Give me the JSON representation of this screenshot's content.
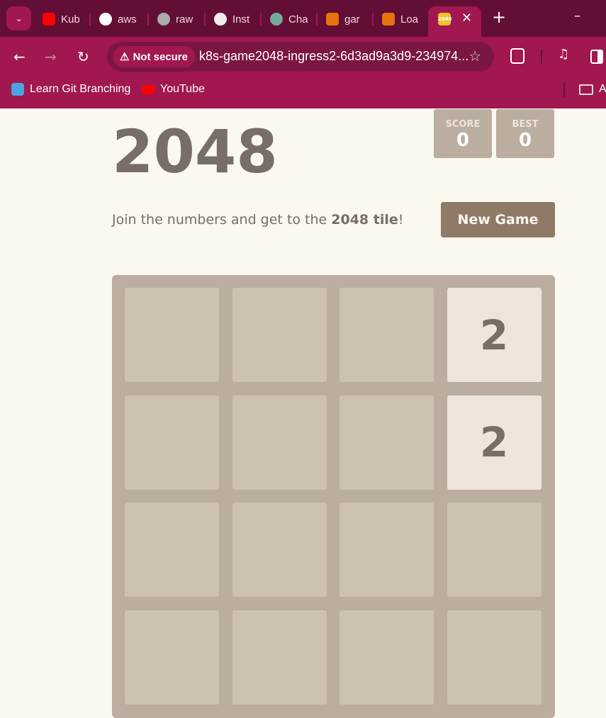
{
  "browser": {
    "tabs": [
      {
        "label": "Kub",
        "icon": "youtube-icon",
        "color": "#ff0000"
      },
      {
        "label": "aws",
        "icon": "github-icon",
        "color": "#ffffff"
      },
      {
        "label": "raw",
        "icon": "globe-icon",
        "color": "#aaaaaa"
      },
      {
        "label": "Inst",
        "icon": "terminal-icon",
        "color": "#eeeeee"
      },
      {
        "label": "Cha",
        "icon": "chatgpt-icon",
        "color": "#74aa9c"
      },
      {
        "label": "gar",
        "icon": "aws-service-icon",
        "color": "#e8730c"
      },
      {
        "label": "Loa",
        "icon": "aws-loadbalancer-icon",
        "color": "#e8730c"
      }
    ],
    "active_tab": {
      "favicon_text": "2048",
      "icon": "game-2048-icon",
      "color": "#edc22e"
    },
    "security_label": "Not secure",
    "url": "k8s-game2048-ingress2-6d3ad9a3d9-234974...",
    "bookmarks": [
      {
        "label": "Learn Git Branching",
        "icon": "git-branching-icon"
      },
      {
        "label": "YouTube",
        "icon": "youtube-icon"
      }
    ],
    "bookmarks_overflow_label": "A"
  },
  "game": {
    "title": "2048",
    "score_label": "SCORE",
    "score": "0",
    "best_label": "BEST",
    "best": "0",
    "intro_prefix": "Join the numbers and get to the ",
    "intro_bold": "2048 tile",
    "intro_suffix": "!",
    "new_game_label": "New Game",
    "board": [
      [
        "",
        "",
        "",
        "2"
      ],
      [
        "",
        "",
        "",
        "2"
      ],
      [
        "",
        "",
        "",
        ""
      ],
      [
        "",
        "",
        "",
        ""
      ]
    ]
  }
}
